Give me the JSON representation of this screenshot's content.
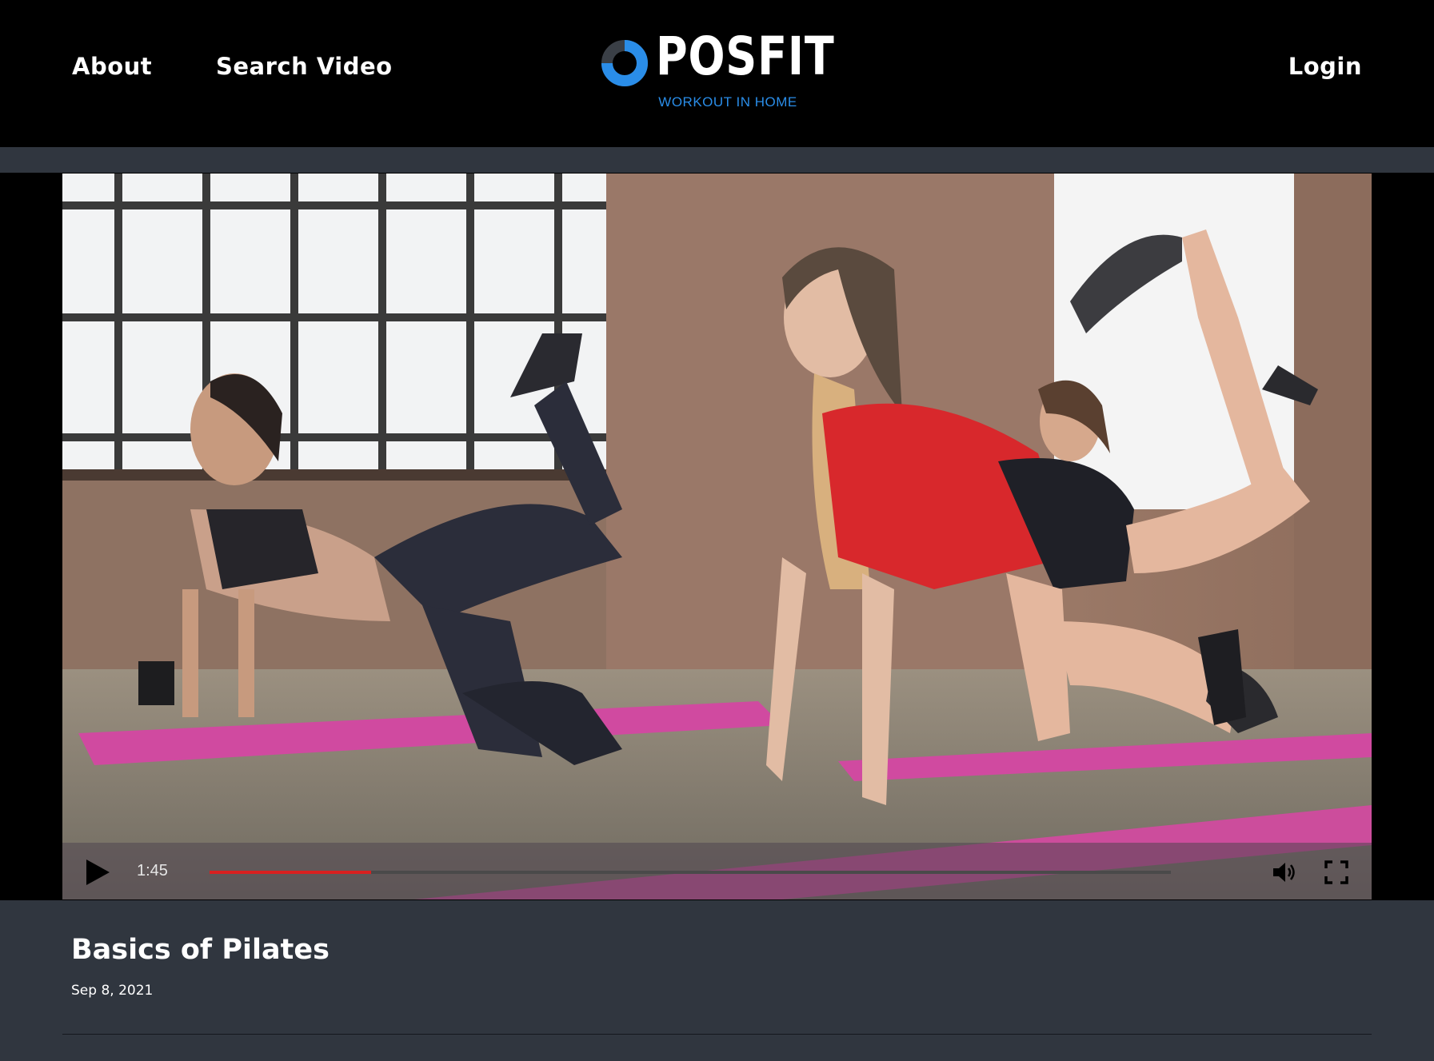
{
  "nav": {
    "about_label": "About",
    "search_label": "Search Video",
    "login_label": "Login"
  },
  "logo": {
    "wordmark": "POSFIT",
    "tagline": "WORKOUT IN HOME"
  },
  "player": {
    "current_time": "1:45",
    "progress_fraction": 0.168,
    "play_icon": "play-icon",
    "volume_icon": "volume-icon",
    "fullscreen_icon": "fullscreen-icon"
  },
  "video": {
    "title": "Basics of Pilates",
    "date": "Sep 8, 2021"
  },
  "colors": {
    "header_bg": "#000000",
    "page_bg": "#30363f",
    "accent_blue": "#2a8de8",
    "progress_red": "#d92020"
  }
}
